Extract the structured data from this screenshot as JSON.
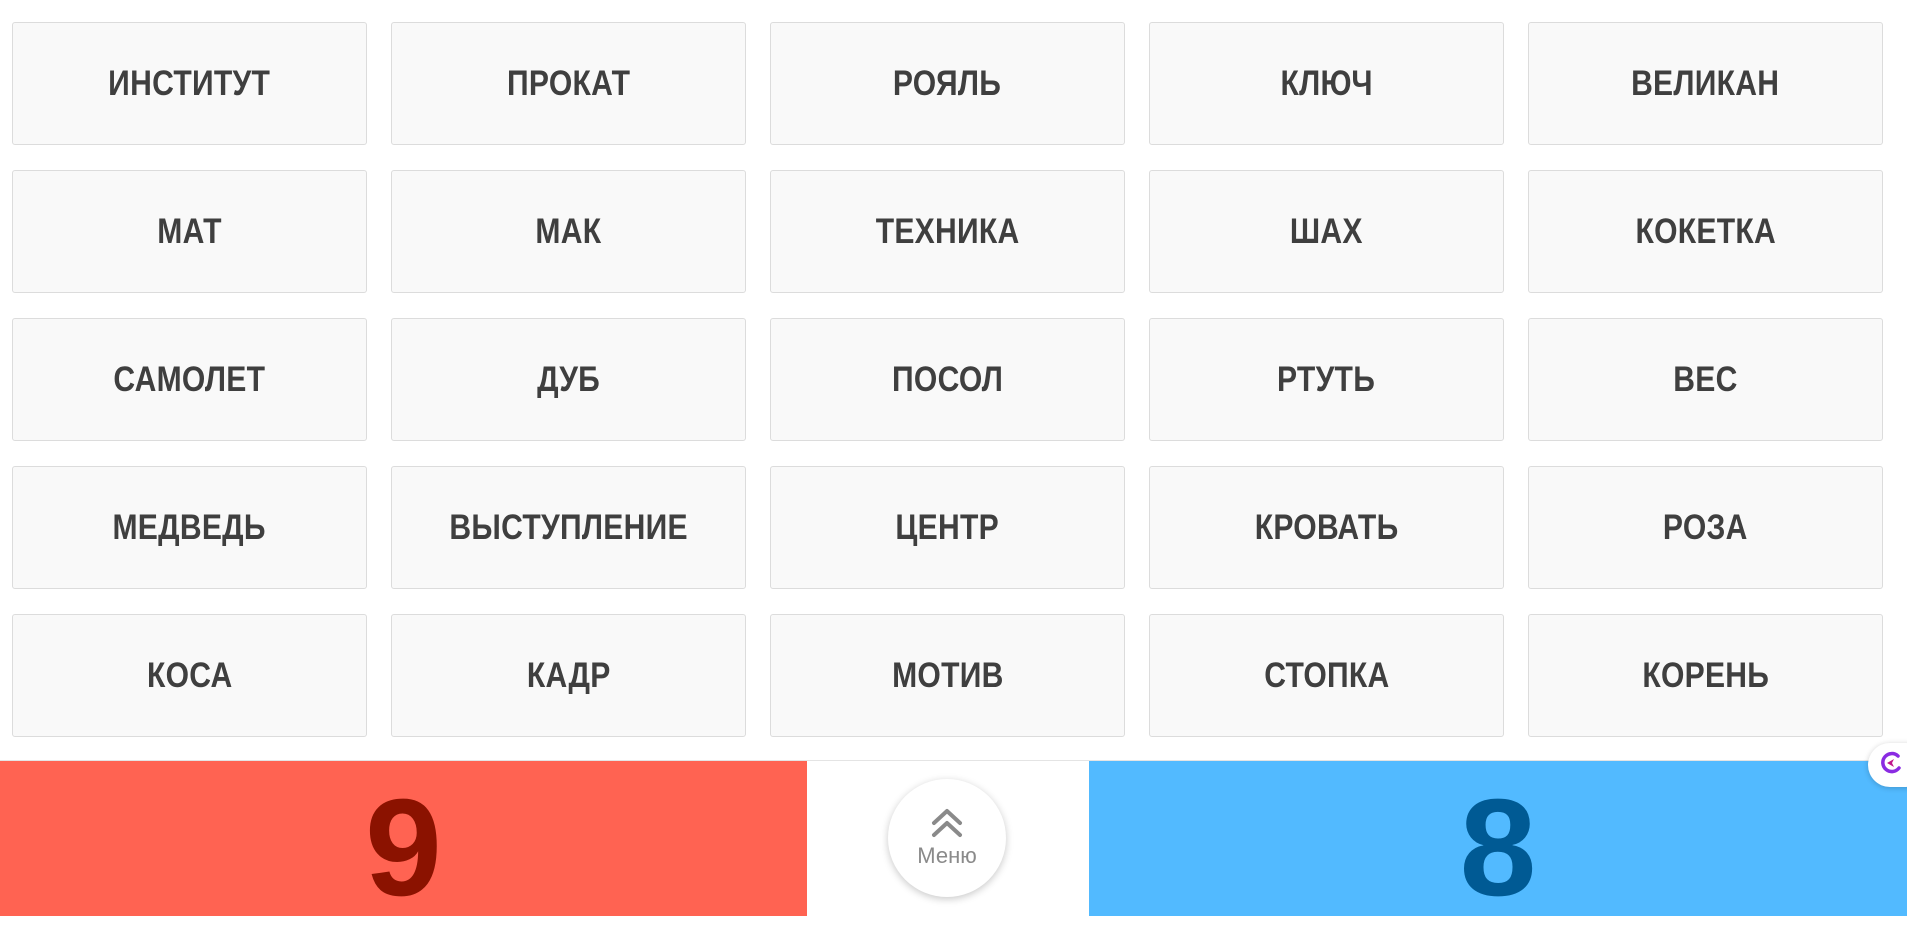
{
  "board": {
    "cards": [
      {
        "word": "ИНСТИТУТ"
      },
      {
        "word": "ПРОКАТ"
      },
      {
        "word": "РОЯЛЬ"
      },
      {
        "word": "КЛЮЧ"
      },
      {
        "word": "ВЕЛИКАН"
      },
      {
        "word": "МАТ"
      },
      {
        "word": "МАК"
      },
      {
        "word": "ТЕХНИКА"
      },
      {
        "word": "ШАХ"
      },
      {
        "word": "КОКЕТКА"
      },
      {
        "word": "САМОЛЕТ"
      },
      {
        "word": "ДУБ"
      },
      {
        "word": "ПОСОЛ"
      },
      {
        "word": "РТУТЬ"
      },
      {
        "word": "ВЕС"
      },
      {
        "word": "МЕДВЕДЬ"
      },
      {
        "word": "ВЫСТУПЛЕНИЕ"
      },
      {
        "word": "ЦЕНТР"
      },
      {
        "word": "КРОВАТЬ"
      },
      {
        "word": "РОЗА"
      },
      {
        "word": "КОСА"
      },
      {
        "word": "КАДР"
      },
      {
        "word": "МОТИВ"
      },
      {
        "word": "СТОПКА"
      },
      {
        "word": "КОРЕНЬ"
      }
    ]
  },
  "footer": {
    "red_team": {
      "score": "9",
      "bg_color": "#ff6352",
      "score_color": "#8b1200"
    },
    "blue_team": {
      "score": "8",
      "bg_color": "#52baff",
      "score_color": "#005a94"
    },
    "menu": {
      "label": "Меню",
      "icon": "double-chevron-up-icon"
    },
    "side_widget": {
      "icon": "assistant-icon",
      "color": "#8a2be2"
    }
  }
}
